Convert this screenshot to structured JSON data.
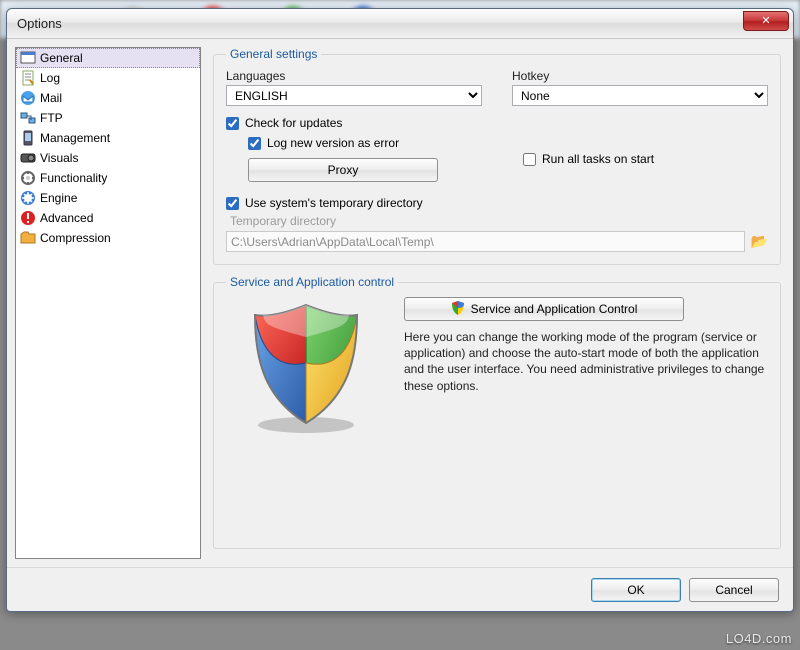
{
  "window": {
    "title": "Options"
  },
  "sidebar": {
    "items": [
      {
        "label": "General",
        "icon": "window-icon"
      },
      {
        "label": "Log",
        "icon": "log-icon"
      },
      {
        "label": "Mail",
        "icon": "mail-icon"
      },
      {
        "label": "FTP",
        "icon": "ftp-icon"
      },
      {
        "label": "Management",
        "icon": "management-icon"
      },
      {
        "label": "Visuals",
        "icon": "visuals-icon"
      },
      {
        "label": "Functionality",
        "icon": "functionality-icon"
      },
      {
        "label": "Engine",
        "icon": "engine-icon"
      },
      {
        "label": "Advanced",
        "icon": "advanced-icon"
      },
      {
        "label": "Compression",
        "icon": "compression-icon"
      }
    ],
    "selected_index": 0
  },
  "general": {
    "group_title": "General settings",
    "languages_label": "Languages",
    "languages_value": "ENGLISH",
    "hotkey_label": "Hotkey",
    "hotkey_value": "None",
    "check_updates_label": "Check for updates",
    "check_updates_checked": true,
    "log_new_version_label": "Log new version as error",
    "log_new_version_checked": true,
    "proxy_button": "Proxy",
    "run_all_tasks_label": "Run all tasks on start",
    "run_all_tasks_checked": false,
    "use_temp_label": "Use system's temporary directory",
    "use_temp_checked": true,
    "temp_dir_caption": "Temporary directory",
    "temp_dir_value": "C:\\Users\\Adrian\\AppData\\Local\\Temp\\"
  },
  "service": {
    "group_title": "Service and Application control",
    "button_label": "Service and Application Control",
    "description": "Here you can change the working mode of the program (service or application) and choose the auto-start mode of both the application and the user interface. You need administrative privileges to change these options."
  },
  "footer": {
    "ok": "OK",
    "cancel": "Cancel"
  },
  "watermark": "LO4D.com"
}
